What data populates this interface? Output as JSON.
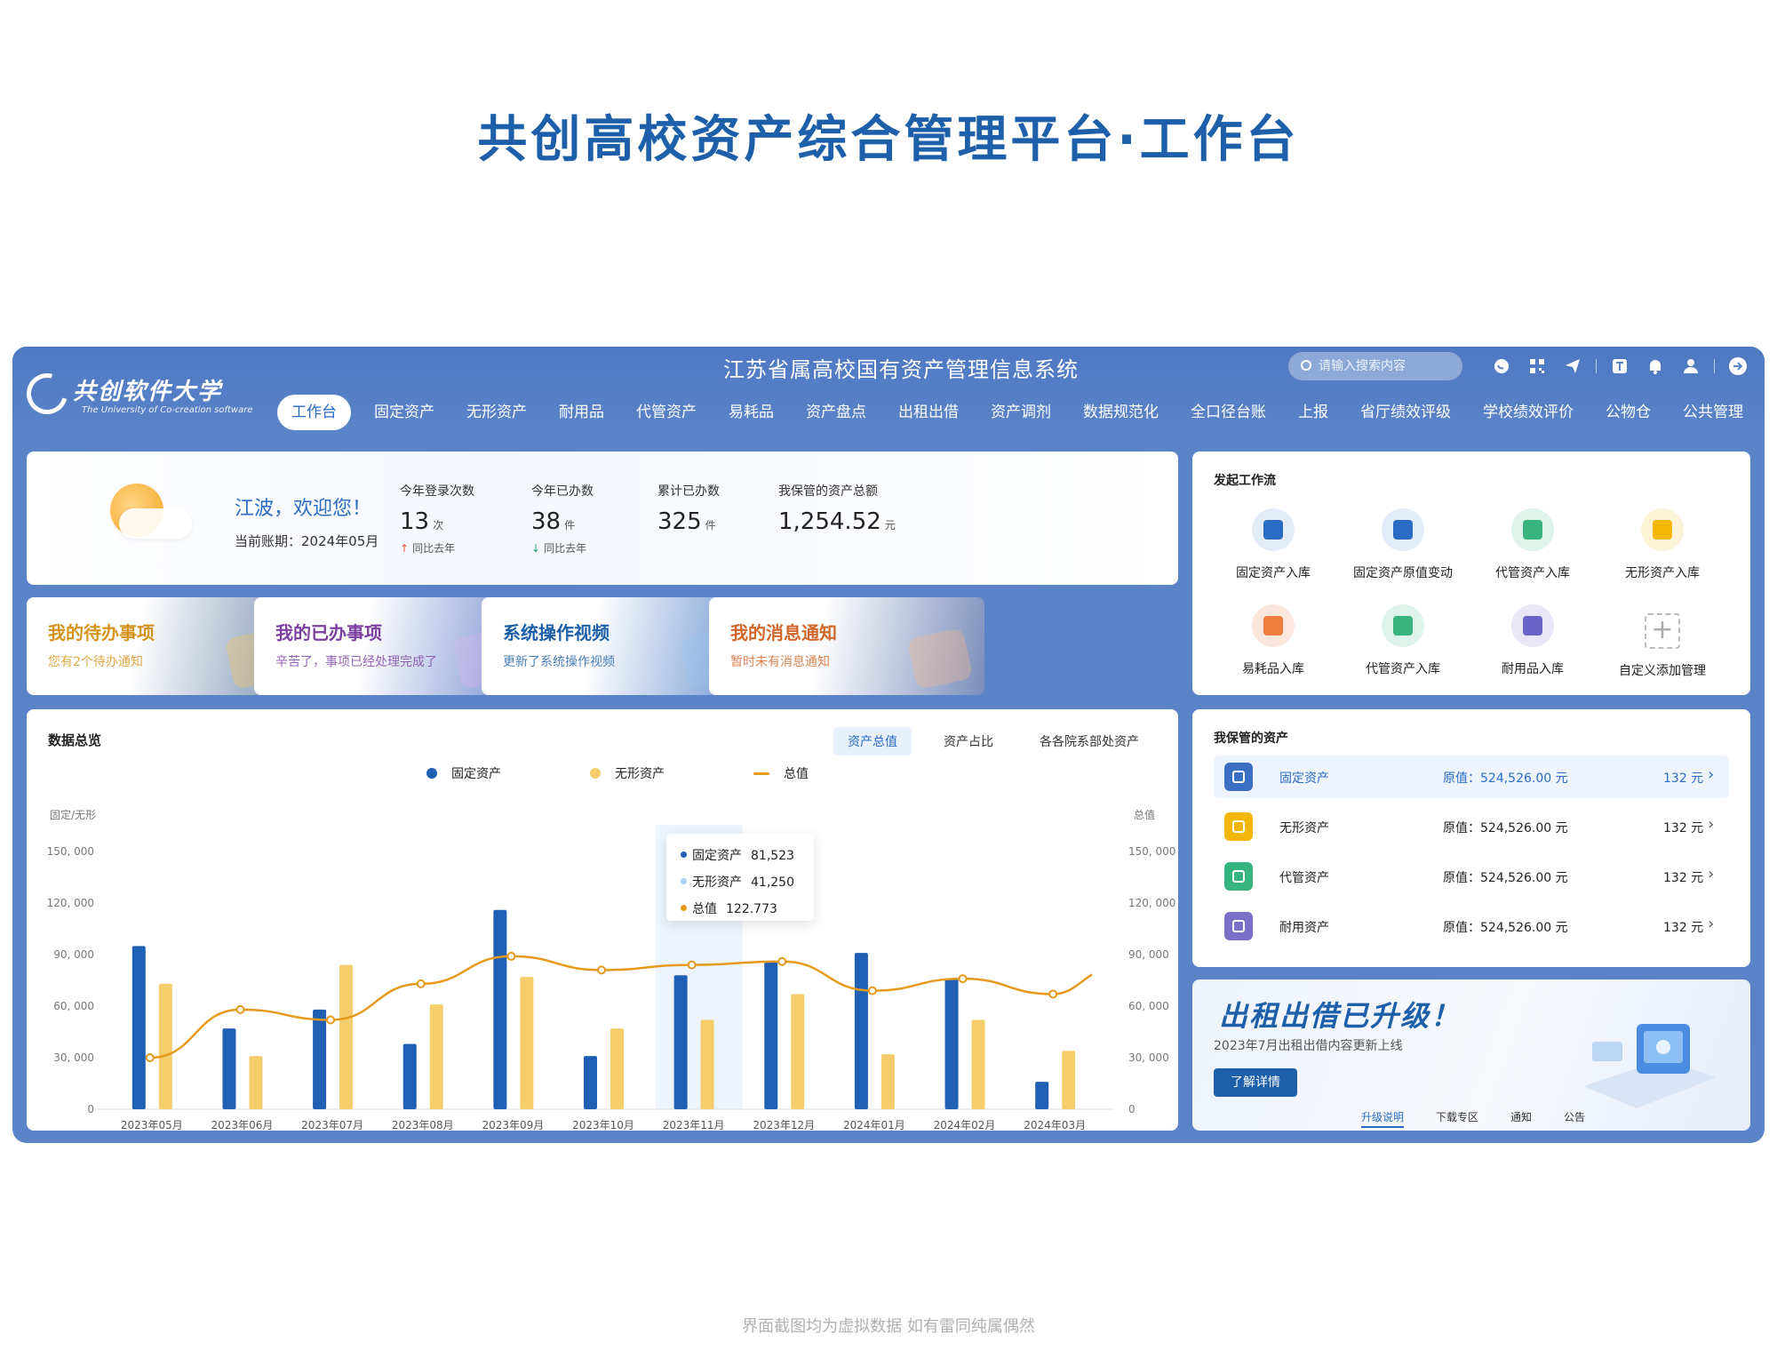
{
  "page_title": "共创高校资产综合管理平台·工作台",
  "footer_note": "界面截图均为虚拟数据 如有雷同纯属偶然",
  "header": {
    "logo_name": "共创软件大学",
    "logo_sub": "The University of Co-creation software",
    "system_title": "江苏省属高校国有资产管理信息系统",
    "search_placeholder": "请输入搜索内容",
    "icons": [
      "wechat-icon",
      "qrcode-icon",
      "send-icon",
      "text-icon",
      "bell-icon",
      "user-icon",
      "logout-icon"
    ],
    "nav": [
      "工作台",
      "固定资产",
      "无形资产",
      "耐用品",
      "代管资产",
      "易耗品",
      "资产盘点",
      "出租出借",
      "资产调剂",
      "数据规范化",
      "全口径台账",
      "上报",
      "省厅绩效评级",
      "学校绩效评价",
      "公物仓",
      "公共管理"
    ]
  },
  "welcome": {
    "greeting": "江波，欢迎您！",
    "period": "当前账期：2024年05月",
    "stats": [
      {
        "label": "今年登录次数",
        "value": "13",
        "unit": "次",
        "trend": "同比去年",
        "direction": "up"
      },
      {
        "label": "今年已办数",
        "value": "38",
        "unit": "件",
        "trend": "同比去年",
        "direction": "down"
      },
      {
        "label": "累计已办数",
        "value": "325",
        "unit": "件",
        "trend": "",
        "direction": ""
      },
      {
        "label": "我保管的资产总额",
        "value": "1,254.52",
        "unit": "元",
        "trend": "",
        "direction": ""
      }
    ]
  },
  "quick_cards": [
    {
      "title": "我的待办事项",
      "subtitle": "您有2个待办通知",
      "color": "#d4931b",
      "deco": "#f6c75c"
    },
    {
      "title": "我的已办事项",
      "subtitle": "辛苦了，事项已经处理完成了",
      "color": "#7b3fa0",
      "deco": "#d9b4f0"
    },
    {
      "title": "系统操作视频",
      "subtitle": "更新了系统操作视频",
      "color": "#1d5fa8",
      "deco": "#9cc4ef"
    },
    {
      "title": "我的消息通知",
      "subtitle": "暂时未有消息通知",
      "color": "#d0662a",
      "deco": "#f7b68a"
    }
  ],
  "workflow": {
    "title": "发起工作流",
    "items": [
      {
        "label": "固定资产入库",
        "bg": "#e3ecf9",
        "fg": "#2a6bc4"
      },
      {
        "label": "固定资产原值变动",
        "bg": "#e3ecf9",
        "fg": "#2a6bc4"
      },
      {
        "label": "代管资产入库",
        "bg": "#def4ea",
        "fg": "#36b37e"
      },
      {
        "label": "无形资产入库",
        "bg": "#fdf3d6",
        "fg": "#f2b705"
      },
      {
        "label": "易耗品入库",
        "bg": "#fde7dc",
        "fg": "#ef7d3c"
      },
      {
        "label": "代管资产入库",
        "bg": "#def4ea",
        "fg": "#36b37e"
      },
      {
        "label": "耐用品入库",
        "bg": "#e8e6f7",
        "fg": "#6b63c7"
      }
    ],
    "add_label": "自定义添加管理"
  },
  "overview": {
    "title": "数据总览",
    "tabs": [
      "资产总值",
      "资产占比",
      "各各院系部处资产"
    ],
    "left_axis_title": "固定/无形",
    "right_axis_title": "总值",
    "tooltip": [
      {
        "label": "固定资产",
        "value": "81,523",
        "color": "#1f5fb4"
      },
      {
        "label": "无形资产",
        "value": "41,250",
        "color": "#a9d3ef"
      },
      {
        "label": "总值",
        "value": "122.773",
        "color": "#e69a1c"
      }
    ]
  },
  "chart_data": {
    "type": "bar",
    "categories": [
      "2023年05月",
      "2023年06月",
      "2023年07月",
      "2023年08月",
      "2023年09月",
      "2023年10月",
      "2023年11月",
      "2023年12月",
      "2024年01月",
      "2024年02月",
      "2024年03月"
    ],
    "series": [
      {
        "name": "固定资产",
        "type": "bar",
        "color": "#1f5fb4",
        "values": [
          95000,
          47000,
          58000,
          38000,
          116000,
          31000,
          78000,
          86000,
          91000,
          76000,
          16000
        ]
      },
      {
        "name": "无形资产",
        "type": "bar",
        "color": "#f5cd6a",
        "values": [
          73000,
          31000,
          84000,
          61000,
          77000,
          47000,
          52000,
          67000,
          32000,
          52000,
          34000
        ]
      },
      {
        "name": "总值",
        "type": "line",
        "color": "#e69a1c",
        "values": [
          30000,
          58000,
          52000,
          73000,
          89000,
          81000,
          84000,
          86000,
          69000,
          76000,
          67000
        ]
      }
    ],
    "left_ticks": [
      "0",
      "30, 000",
      "60, 000",
      "90, 000",
      "120, 000",
      "150, 000"
    ],
    "right_ticks": [
      "0",
      "30, 000",
      "60, 000",
      "90, 000",
      "120, 000",
      "150, 000"
    ],
    "ylim": [
      0,
      150000
    ],
    "highlight_index": 6,
    "grid": false,
    "legend": "top-center"
  },
  "assets": {
    "title": "我保管的资产",
    "rows": [
      {
        "name": "固定资产",
        "value": "原值：524,526.00 元",
        "count": "132 元",
        "color": "#3a6fc4",
        "active": true
      },
      {
        "name": "无形资产",
        "value": "原值：524,526.00 元",
        "count": "132 元",
        "color": "#f2b705",
        "active": false
      },
      {
        "name": "代管资产",
        "value": "原值：524,526.00 元",
        "count": "132 元",
        "color": "#36b37e",
        "active": false
      },
      {
        "name": "耐用资产",
        "value": "原值：524,526.00 元",
        "count": "132 元",
        "color": "#7a6fc9",
        "active": false
      }
    ]
  },
  "promo": {
    "title": "出租出借已升级！",
    "subtitle": "2023年7月出租出借内容更新上线",
    "button": "了解详情",
    "tabs": [
      "升级说明",
      "下载专区",
      "通知",
      "公告"
    ]
  }
}
